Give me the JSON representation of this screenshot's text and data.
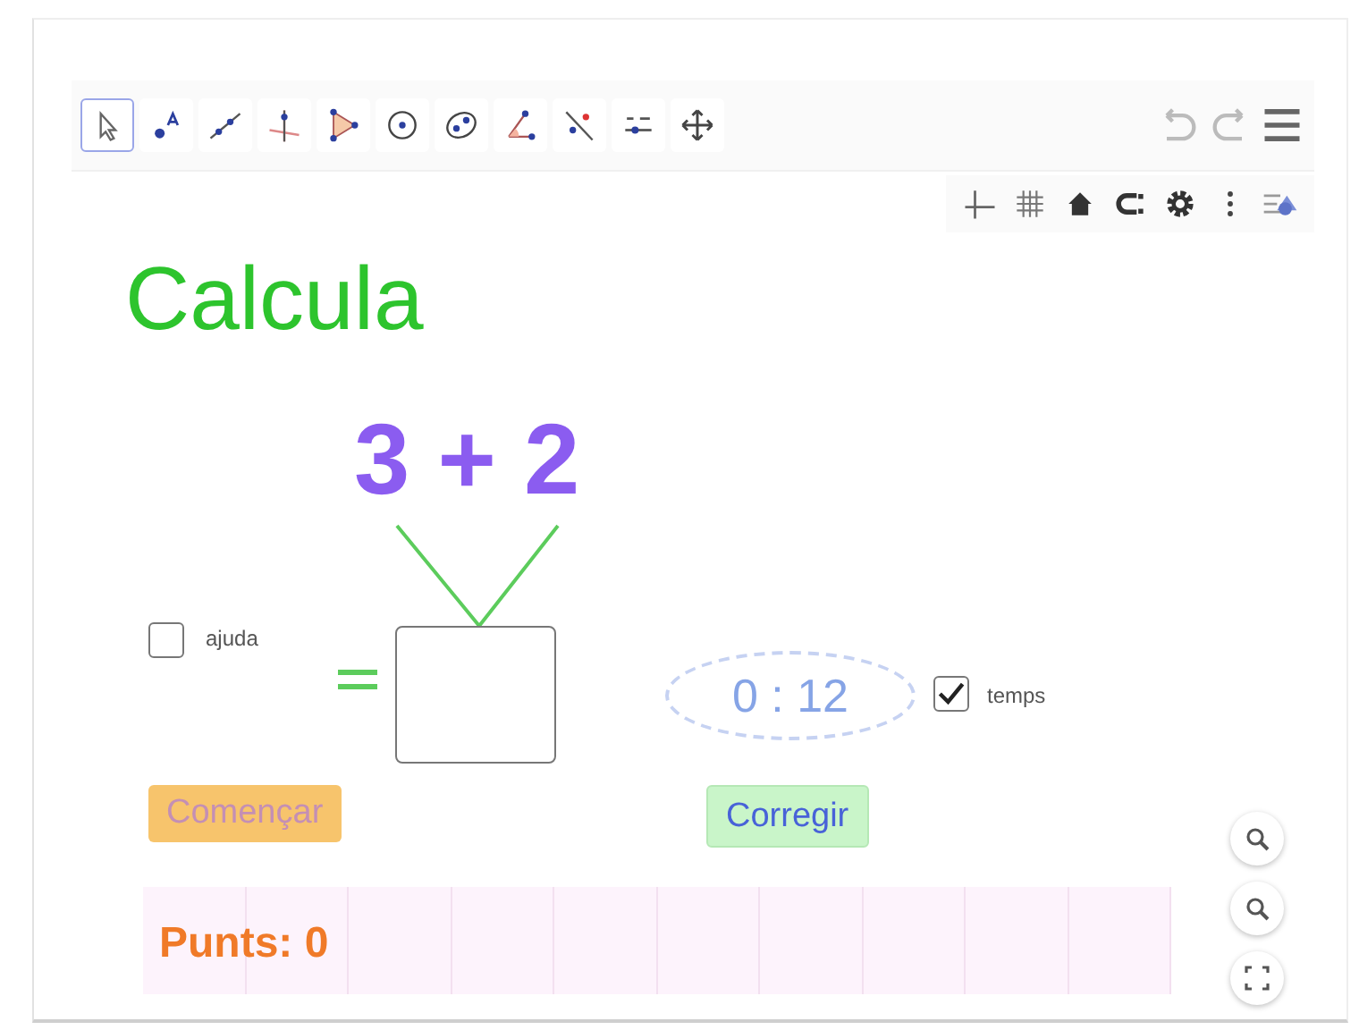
{
  "toolbar": {
    "tools": [
      {
        "kind": "move",
        "selected": true
      },
      {
        "kind": "point",
        "selected": false
      },
      {
        "kind": "line",
        "selected": false
      },
      {
        "kind": "perpendicular",
        "selected": false
      },
      {
        "kind": "polygon",
        "selected": false
      },
      {
        "kind": "circle",
        "selected": false
      },
      {
        "kind": "conic",
        "selected": false
      },
      {
        "kind": "angle",
        "selected": false
      },
      {
        "kind": "reflect",
        "selected": false
      },
      {
        "kind": "slider",
        "selected": false
      },
      {
        "kind": "pan",
        "selected": false
      }
    ]
  },
  "title": "Calcula",
  "expression": "3 + 2",
  "checkboxes": [
    {
      "label": "ajuda",
      "checked": false
    },
    {
      "label": "temps",
      "checked": true
    }
  ],
  "timer": "0 : 12",
  "buttons": [
    {
      "kind": "start",
      "label": "Començar"
    },
    {
      "kind": "check",
      "label": "Corregir"
    }
  ],
  "score": "Punts: 0"
}
